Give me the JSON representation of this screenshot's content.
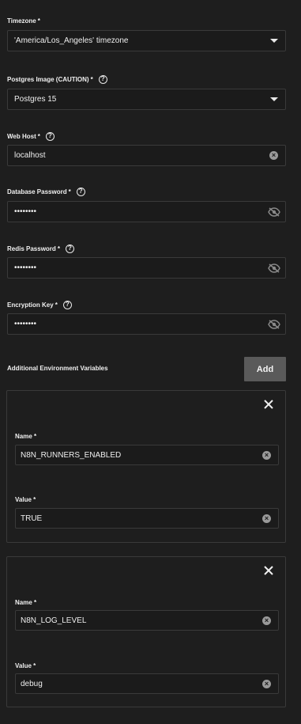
{
  "fields": {
    "timezone": {
      "label": "Timezone",
      "required": "*",
      "value": "'America/Los_Angeles' timezone"
    },
    "postgres_image": {
      "label": "Postgres Image (CAUTION)",
      "required": "*",
      "value": "Postgres 15"
    },
    "web_host": {
      "label": "Web Host",
      "required": "*",
      "value": "localhost"
    },
    "database_password": {
      "label": "Database Password",
      "required": "*",
      "value": "••••••••"
    },
    "redis_password": {
      "label": "Redis Password",
      "required": "*",
      "value": "••••••••"
    },
    "encryption_key": {
      "label": "Encryption Key",
      "required": "*",
      "value": "••••••••"
    }
  },
  "env_section": {
    "title": "Additional Environment Variables",
    "add_label": "Add"
  },
  "env_vars": [
    {
      "name_label": "Name",
      "name_req": "*",
      "name": "N8N_RUNNERS_ENABLED",
      "value_label": "Value",
      "value_req": "*",
      "value": "TRUE"
    },
    {
      "name_label": "Name",
      "name_req": "*",
      "name": "N8N_LOG_LEVEL",
      "value_label": "Value",
      "value_req": "*",
      "value": "debug"
    }
  ],
  "icons": {
    "help": "?",
    "clear": "×"
  },
  "colors": {
    "background": "#1e1e1e",
    "input_border": "#3a3a3a",
    "add_button": "#5a5a5a"
  }
}
